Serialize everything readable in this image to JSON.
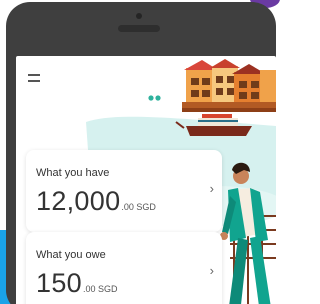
{
  "menu": {
    "icon": "hamburger-menu-icon"
  },
  "cards": {
    "have": {
      "label": "What you have",
      "amount_major": "12,000",
      "amount_minor": ".00 SGD",
      "chevron": "›"
    },
    "owe": {
      "label": "What you owe",
      "amount_major": "150",
      "amount_minor": ".00 SGD",
      "chevron": "›"
    }
  },
  "colors": {
    "accent_blue": "#1aa3e8",
    "accent_purple": "#6a3aa2",
    "phone_body": "#3f3f3f",
    "mint": "#cdeeed",
    "building_orange": "#f0a24a",
    "teal": "#11a48f"
  }
}
